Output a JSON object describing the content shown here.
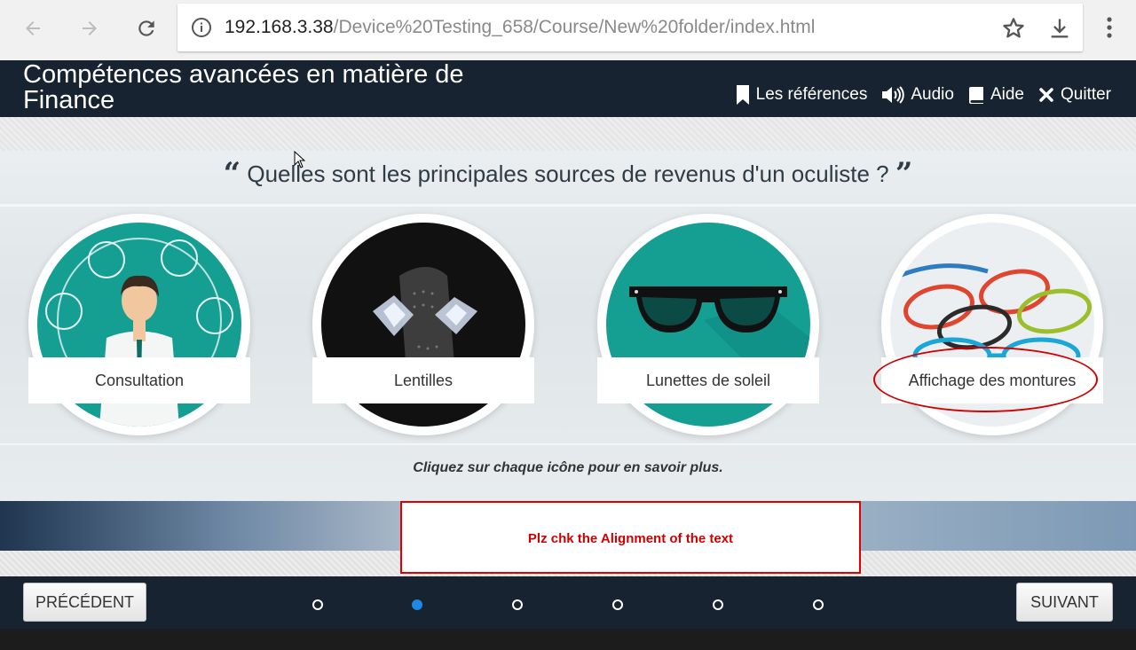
{
  "browser": {
    "url_host": "192.168.3.38",
    "url_path": "/Device%20Testing_658/Course/New%20folder/index.html"
  },
  "header": {
    "title": "Compétences avancées en matière de Finance",
    "menu": [
      {
        "label": "Les références",
        "icon": "bookmark-icon"
      },
      {
        "label": "Audio",
        "icon": "speaker-icon"
      },
      {
        "label": "Aide",
        "icon": "book-icon"
      },
      {
        "label": "Quitter",
        "icon": "close-icon"
      }
    ]
  },
  "main": {
    "question": "Quelles sont les principales sources de revenus d'un oculiste ?",
    "cards": [
      {
        "label": "Consultation",
        "icon": "doctor-icon"
      },
      {
        "label": "Lentilles",
        "icon": "contact-lens-icon"
      },
      {
        "label": "Lunettes de soleil",
        "icon": "sunglasses-icon"
      },
      {
        "label": "Affichage des montures",
        "icon": "eyeglass-frames-icon"
      }
    ],
    "hint": "Cliquez sur chaque icône pour en savoir plus."
  },
  "annotation": {
    "text": "Plz chk the Alignment of the text",
    "color": "#d10000"
  },
  "footer": {
    "prev_label": "PRÉCÉDENT",
    "next_label": "SUIVANT",
    "dot_count": 6,
    "active_dot": 2
  },
  "colors": {
    "header_bg": "#172330",
    "active_dot": "#1e88e5",
    "teal": "#159f93"
  }
}
